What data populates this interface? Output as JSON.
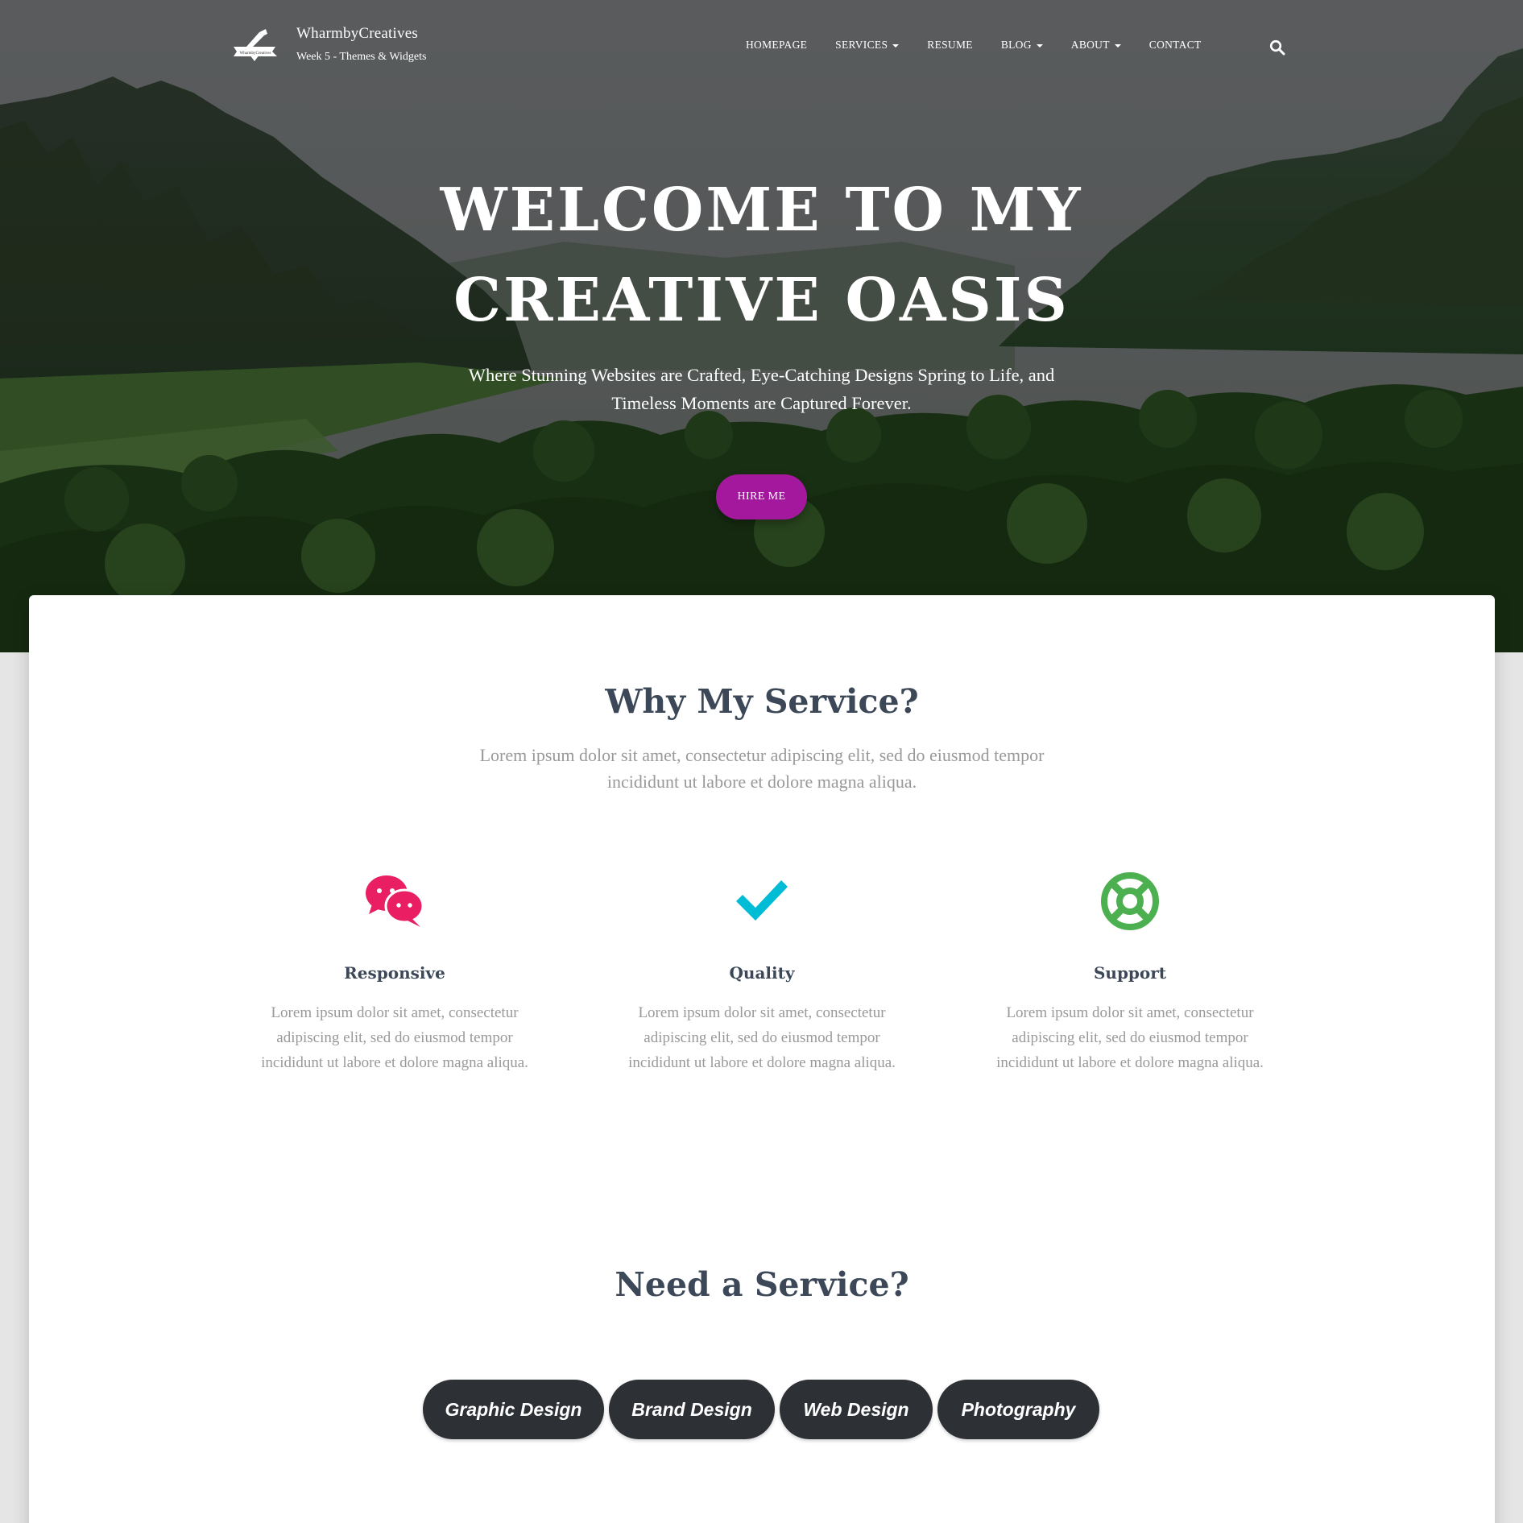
{
  "brand": {
    "title": "WharmbyCreatives",
    "tagline": "Week 5 - Themes & Widgets",
    "logo_text": "WharmbyCreatives"
  },
  "nav": {
    "items": [
      {
        "label": "HOMEPAGE",
        "dropdown": false
      },
      {
        "label": "SERVICES",
        "dropdown": true
      },
      {
        "label": "RESUME",
        "dropdown": false
      },
      {
        "label": "BLOG",
        "dropdown": true
      },
      {
        "label": "ABOUT",
        "dropdown": true
      },
      {
        "label": "CONTACT",
        "dropdown": false
      }
    ],
    "search_icon": "search-icon"
  },
  "hero": {
    "title_line1": "WELCOME TO MY",
    "title_line2": "CREATIVE OASIS",
    "subtitle_line1": "Where Stunning Websites are Crafted, Eye-Catching Designs Spring to Life, and",
    "subtitle_line2": "Timeless Moments are Captured Forever.",
    "button": "HIRE ME",
    "button_color": "#a3189c"
  },
  "why": {
    "title": "Why My Service?",
    "desc_line1": "Lorem ipsum dolor sit amet, consectetur adipiscing elit, sed do eiusmod tempor",
    "desc_line2": "incididunt ut labore et dolore magna aliqua.",
    "features": [
      {
        "title": "Responsive",
        "icon": "chat-bubbles-icon",
        "color": "#e91e63",
        "text_line1": "Lorem ipsum dolor sit amet, consectetur",
        "text_line2": "adipiscing elit, sed do eiusmod tempor",
        "text_line3": "incididunt ut labore et dolore magna aliqua."
      },
      {
        "title": "Quality",
        "icon": "checkmark-icon",
        "color": "#00bcd4",
        "text_line1": "Lorem ipsum dolor sit amet, consectetur",
        "text_line2": "adipiscing elit, sed do eiusmod tempor",
        "text_line3": "incididunt ut labore et dolore magna aliqua."
      },
      {
        "title": "Support",
        "icon": "life-ring-icon",
        "color": "#4caf50",
        "text_line1": "Lorem ipsum dolor sit amet, consectetur",
        "text_line2": "adipiscing elit, sed do eiusmod tempor",
        "text_line3": "incididunt ut labore et dolore magna aliqua."
      }
    ]
  },
  "need": {
    "title": "Need a Service?",
    "services": [
      "Graphic Design",
      "Brand Design",
      "Web Design",
      "Photography"
    ]
  }
}
